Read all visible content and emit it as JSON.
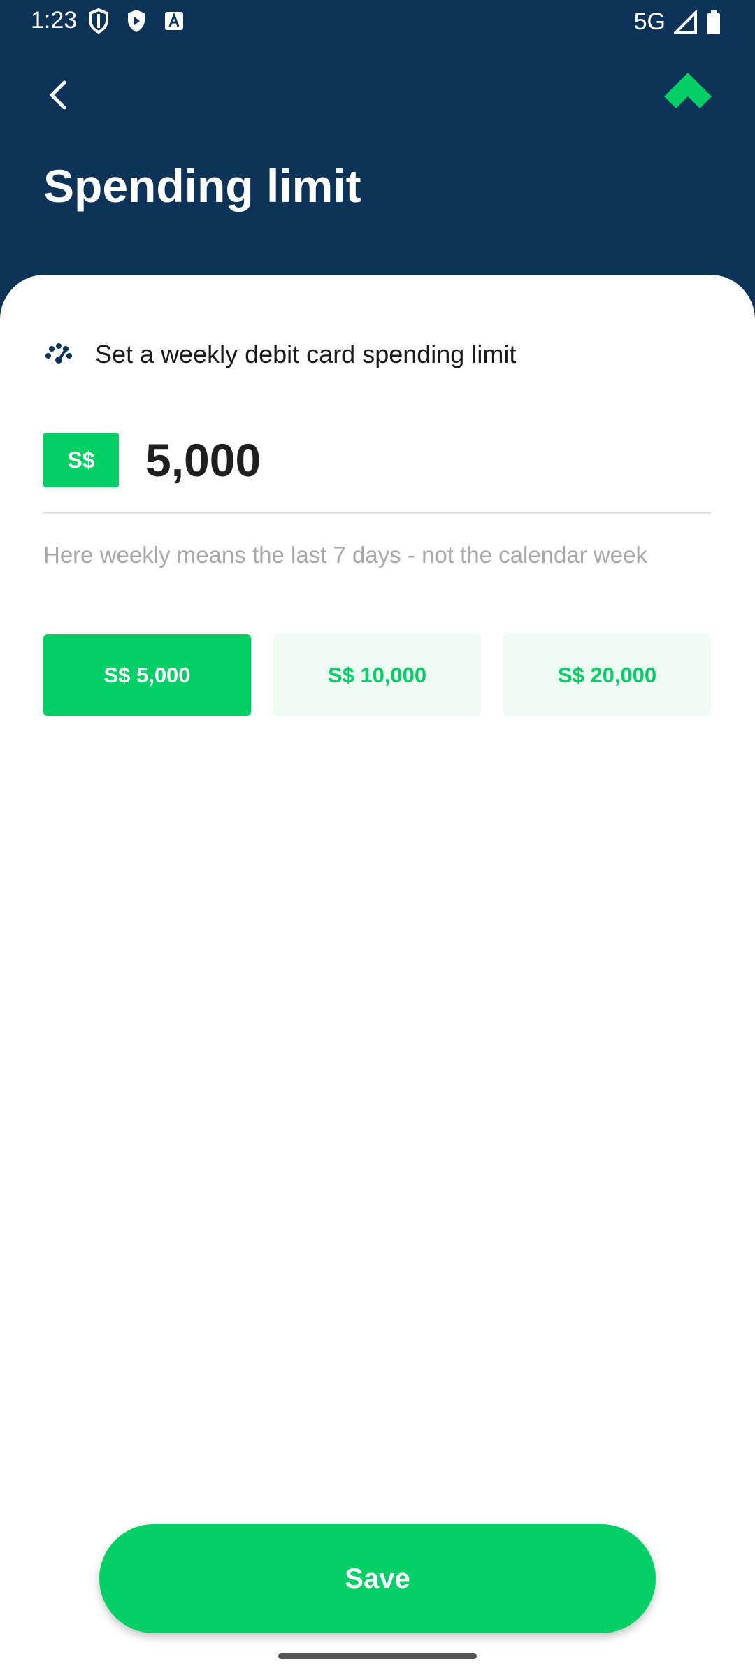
{
  "status_bar": {
    "time": "1:23",
    "network": "5G"
  },
  "header": {
    "title": "Spending limit"
  },
  "info": {
    "text": "Set a weekly debit card spending limit"
  },
  "amount": {
    "currency": "S$",
    "value": "5,000"
  },
  "hint": "Here weekly means the last 7 days - not the calendar week",
  "presets": [
    {
      "label": "S$ 5,000",
      "selected": true
    },
    {
      "label": "S$ 10,000",
      "selected": false
    },
    {
      "label": "S$ 20,000",
      "selected": false
    }
  ],
  "save_label": "Save",
  "colors": {
    "header_bg": "#0d3358",
    "accent": "#03cf67",
    "accent_light": "#eefbf3"
  },
  "icons": [
    "back-arrow-icon",
    "brand-logo-icon",
    "gauge-icon",
    "shield-icon",
    "play-protect-icon",
    "font-icon",
    "signal-icon",
    "battery-icon"
  ]
}
